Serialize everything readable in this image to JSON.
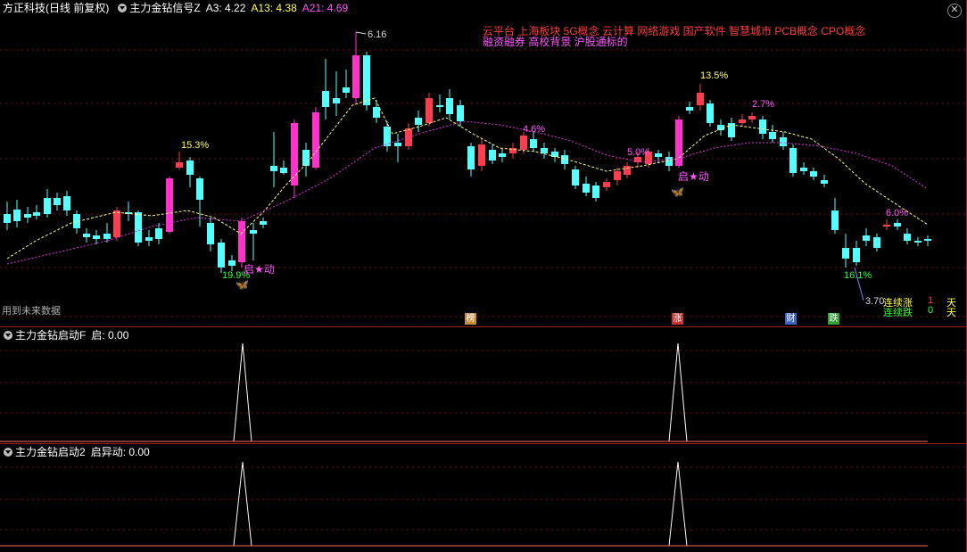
{
  "main_pane": {
    "stock_name": "方正科技",
    "period": "(日线 前复权)",
    "indicator_name": "主力金钻信号Z",
    "a3": "A3: 4.22",
    "a13": "A13: 4.38",
    "a21": "A21: 4.69",
    "close_glyph": "✕",
    "concepts_line1": "云平台    上海板块  5G概念 云计算 网络游戏 国产软件 智慧城市 PCB概念 CPO概念",
    "concepts_line2": "融资融券 高校背景 沪股通标的",
    "future_note": "用到未来数据",
    "high_label": "6.16",
    "low_label": "3.70",
    "start_label": "启★动",
    "pct_labels": [
      "15.3%",
      "19.9%",
      "4.6%",
      "5.0%",
      "13.5%",
      "2.7%",
      "6.0%",
      "16.1%"
    ],
    "badges": [
      {
        "text": "榜",
        "color": "#c88a3c"
      },
      {
        "text": "涨",
        "color": "#c83232"
      },
      {
        "text": "财",
        "color": "#3c64c8"
      },
      {
        "text": "跌",
        "color": "#32a032"
      }
    ],
    "stats": {
      "up_label": "连续涨",
      "up_value": "1",
      "up_unit": "天",
      "down_label": "连续跌",
      "down_value": "0",
      "down_unit": "天"
    },
    "butterfly_glyph": "🦋"
  },
  "pane2": {
    "indicator_name": "主力金钻启动F",
    "value_text": "启: 0.00"
  },
  "pane3": {
    "indicator_name": "主力金钻启动2",
    "value_text": "启异动: 0.00"
  },
  "colors": {
    "up": "#ff3c50",
    "down": "#54ffff",
    "signal": "#ff33cc",
    "ma_yellow": "#ffff80",
    "ma_magenta": "#dd33dd",
    "grid": "#7a1010",
    "spike": "#ffffff"
  }
}
